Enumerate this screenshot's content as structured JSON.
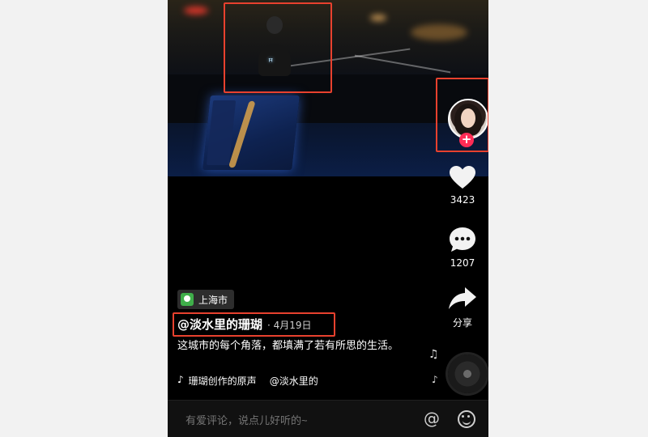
{
  "location": {
    "label": "上海市",
    "icon": "location-pin-icon"
  },
  "post": {
    "author": "@淡水里的珊瑚",
    "date": "· 4月19日",
    "caption": "这城市的每个角落，都填满了若有所思的生活。",
    "sound": "珊瑚创作的原声",
    "sound_mention": "@淡水里的"
  },
  "rail": {
    "like_count": "3423",
    "comment_count": "1207",
    "share_label": "分享"
  },
  "comment_bar": {
    "placeholder": "有爱评论，说点儿好听的~",
    "mention_glyph": "@"
  },
  "colors": {
    "highlight": "#e8412e",
    "follow_accent": "#fe2c55",
    "location_pin": "#3fae4a"
  }
}
